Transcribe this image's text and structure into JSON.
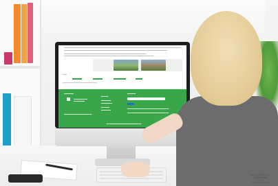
{
  "watermark": {
    "lines": [
      "KONSTANCIN-",
      "JEZIORNA",
      "WOJCIECH",
      "URZĄD MIASTA I GMINY"
    ]
  },
  "colors": {
    "footer_green": "#3aa64a",
    "button_blue": "#1f6fbf",
    "binder_orange": "#f08a2a",
    "binder_pink": "#e0607e",
    "binder_teal": "#1f9ec9"
  }
}
